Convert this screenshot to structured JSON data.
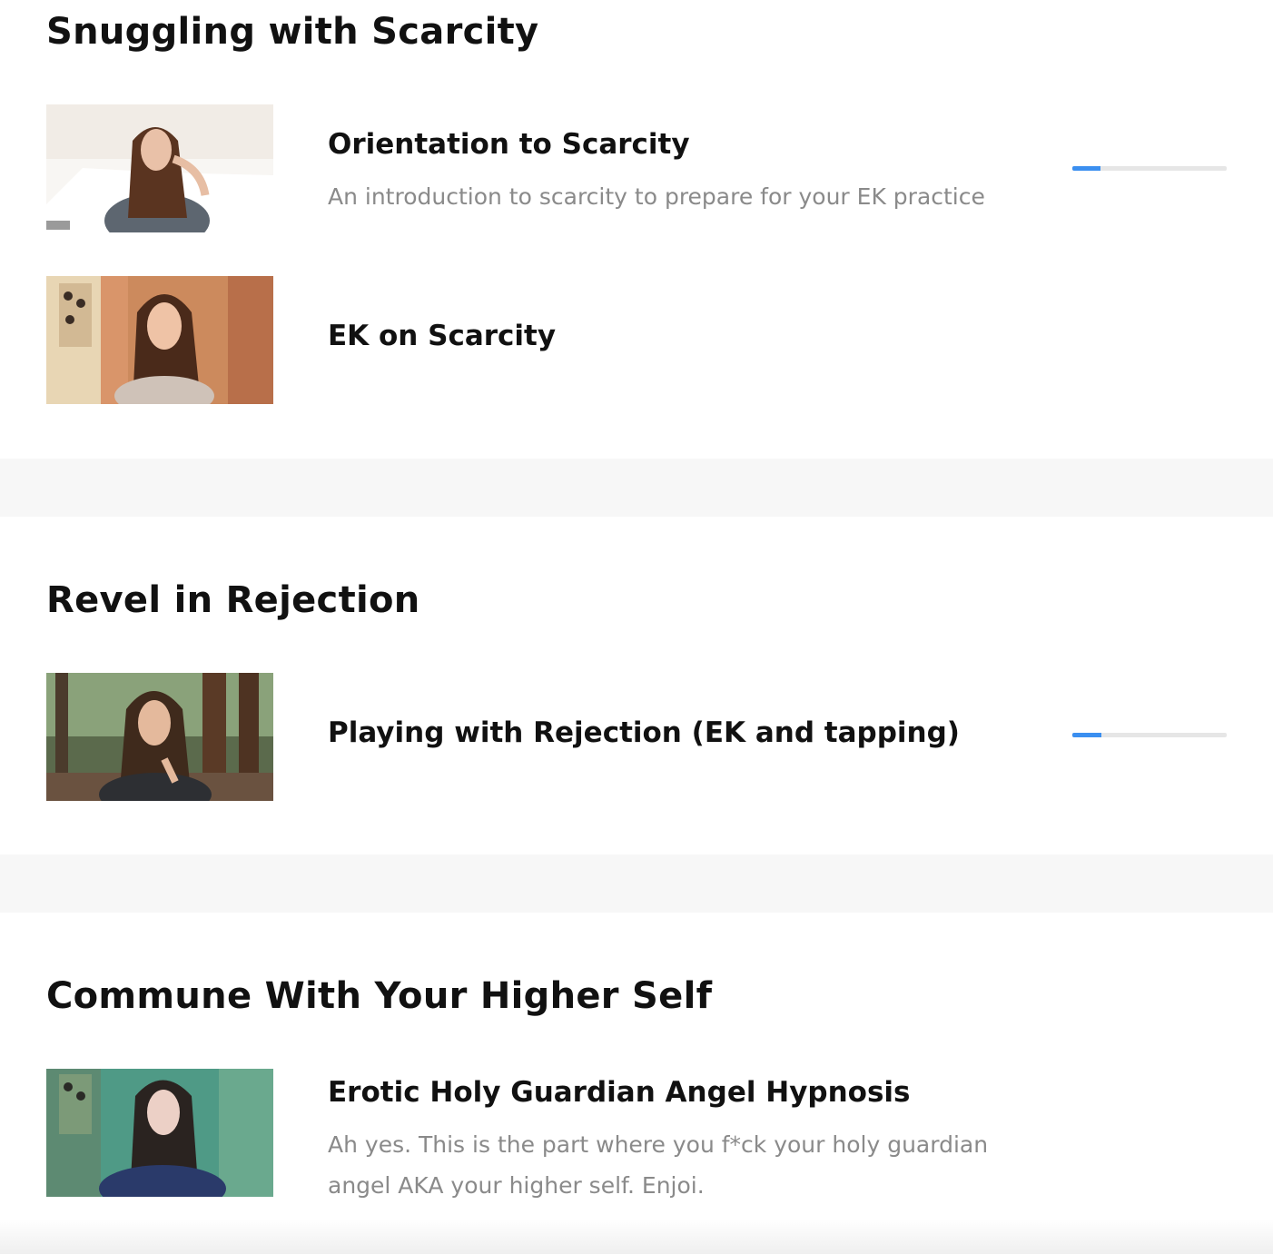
{
  "sections": [
    {
      "title": "Snuggling with Scarcity",
      "lessons": [
        {
          "title": "Orientation to Scarcity",
          "description": "An introduction to scarcity to prepare for your EK practice",
          "progress_percent": 18
        },
        {
          "title": "EK on Scarcity"
        }
      ]
    },
    {
      "title": "Revel in Rejection",
      "lessons": [
        {
          "title": "Playing with Rejection (EK and tapping)",
          "progress_percent": 19
        }
      ]
    },
    {
      "title": "Commune With Your Higher Self",
      "lessons": [
        {
          "title": "Erotic Holy Guardian Angel Hypnosis",
          "description": "Ah yes. This is the part where you f*ck your holy guardian angel AKA your higher self. Enjoi."
        }
      ]
    }
  ],
  "colors": {
    "progress_fill": "#3b8ff0",
    "progress_track": "#e6e6e6",
    "divider": "#f7f7f7",
    "description_text": "#8a8a8a"
  }
}
